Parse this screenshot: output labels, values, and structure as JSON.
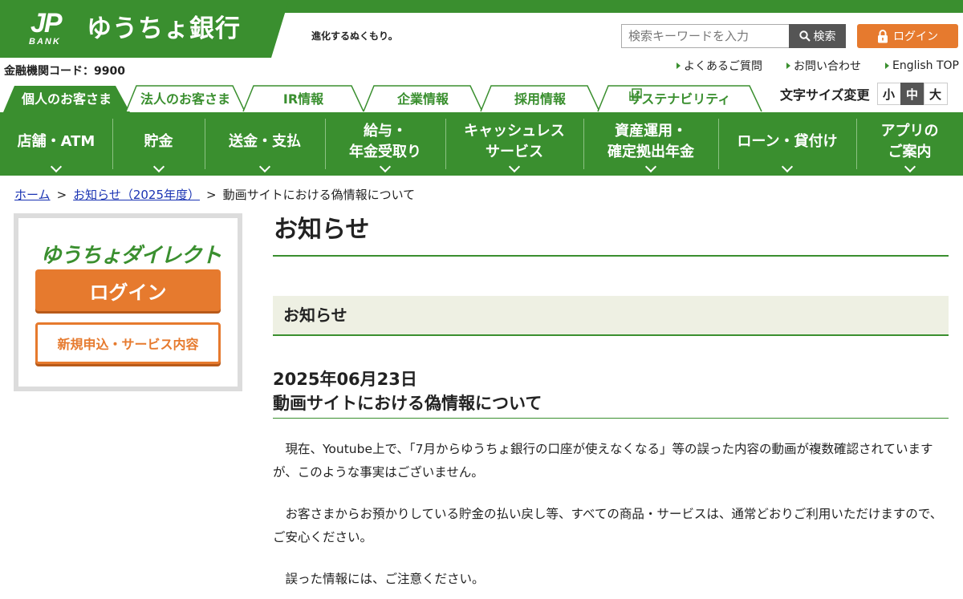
{
  "brand": {
    "jp": "JP",
    "bank": "BANK",
    "name": "ゆうちょ銀行",
    "tagline": "進化するぬくもり。"
  },
  "bank_code": "金融機関コード：9900",
  "search": {
    "placeholder": "検索キーワードを入力",
    "button": "検索"
  },
  "login_button": "ログイン",
  "utility_links": [
    "よくあるご質問",
    "お問い合わせ",
    "English TOP"
  ],
  "tabs": [
    "個人のお客さま",
    "法人のお客さま",
    "IR情報",
    "企業情報",
    "採用情報",
    "サステナビリティ"
  ],
  "font_size": {
    "label": "文字サイズ変更",
    "options": [
      "小",
      "中",
      "大"
    ],
    "selected": "中"
  },
  "main_nav": [
    "店舗・ATM",
    "貯金",
    "送金・支払",
    "給与・\n年金受取り",
    "キャッシュレス\nサービス",
    "資産運用・\n確定拠出年金",
    "ローン・貸付け",
    "アプリの\nご案内"
  ],
  "breadcrumb": {
    "home": "ホーム",
    "parent": "お知らせ（2025年度）",
    "current": "動画サイトにおける偽情報について",
    "sep": ">"
  },
  "sidebar": {
    "title": "ゆうちょダイレクト",
    "login": "ログイン",
    "apply": "新規申込・サービス内容"
  },
  "main": {
    "page_title": "お知らせ",
    "section": "お知らせ",
    "date": "2025年06月23日",
    "title": "動画サイトにおける偽情報について",
    "paragraphs": [
      "現在、Youtube上で、「7月からゆうちょ銀行の口座が使えなくなる」等の誤った内容の動画が複数確認されていますが、このような事実はございません。",
      "お客さまからお預かりしている貯金の払い戻し等、すべての商品・サービスは、通常どおりご利用いただけますので、ご安心ください。",
      "誤った情報には、ご注意ください。"
    ]
  },
  "colors": {
    "brand_green": "#3a8f2f",
    "orange": "#e67a2e",
    "link_blue": "#1a33b3"
  }
}
